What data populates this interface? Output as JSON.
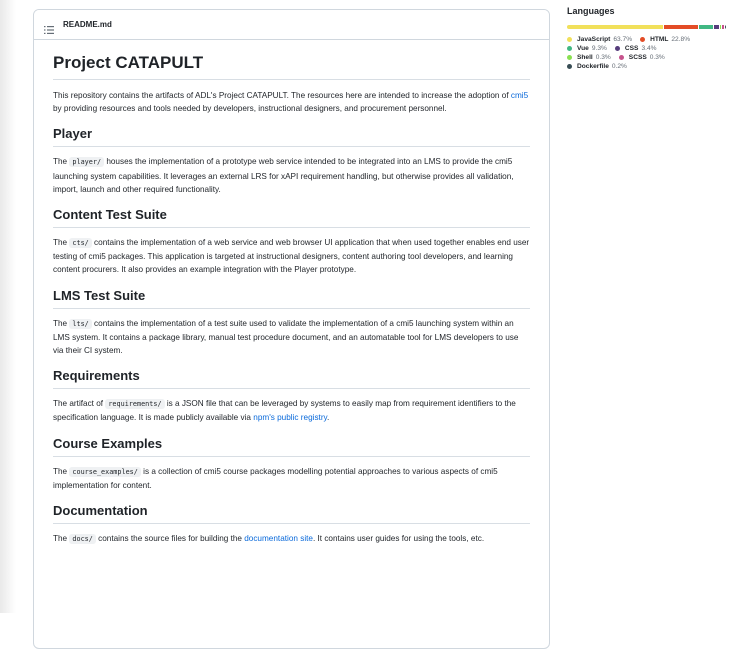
{
  "readme": {
    "filename": "README.md",
    "title": "Project CATAPULT",
    "intro": {
      "before": "This repository contains the artifacts of ADL's Project CATAPULT. The resources here are intended to increase the adoption of ",
      "link": "cmi5",
      "after": " by providing resources and tools needed by developers, instructional designers, and procurement personnel."
    },
    "sections": {
      "player": {
        "heading": "Player",
        "before": "The ",
        "code": "player/",
        "after": " houses the implementation of a prototype web service intended to be integrated into an LMS to provide the cmi5 launching system capabilities. It leverages an external LRS for xAPI requirement handling, but otherwise provides all validation, import, launch and other required functionality."
      },
      "cts": {
        "heading": "Content Test Suite",
        "before": "The ",
        "code": "cts/",
        "after": " contains the implementation of a web service and web browser UI application that when used together enables end user testing of cmi5 packages. This application is targeted at instructional designers, content authoring tool developers, and learning content procurers. It also provides an example integration with the Player prototype."
      },
      "lts": {
        "heading": "LMS Test Suite",
        "before": "The ",
        "code": "lts/",
        "after": " contains the implementation of a test suite used to validate the implementation of a cmi5 launching system within an LMS system. It contains a package library, manual test procedure document, and an automatable tool for LMS developers to use via their CI system."
      },
      "requirements": {
        "heading": "Requirements",
        "before": "The artifact of ",
        "code": "requirements/",
        "middle": " is a JSON file that can be leveraged by systems to easily map from requirement identifiers to the specification language. It is made publicly available via ",
        "link": "npm's public registry",
        "after": "."
      },
      "course": {
        "heading": "Course Examples",
        "before": "The ",
        "code": "course_examples/",
        "after": " is a collection of cmi5 course packages modelling potential approaches to various aspects of cmi5 implementation for content."
      },
      "docs": {
        "heading": "Documentation",
        "before": "The ",
        "code": "docs/",
        "middle": " contains the source files for building the ",
        "link": "documentation site",
        "after": ". It contains user guides for using the tools, etc."
      }
    }
  },
  "languages": {
    "title": "Languages",
    "items": [
      {
        "name": "JavaScript",
        "pct": "63.7%",
        "value": 63.7,
        "color": "#f1e05a"
      },
      {
        "name": "HTML",
        "pct": "22.8%",
        "value": 22.8,
        "color": "#e34c26"
      },
      {
        "name": "Vue",
        "pct": "9.3%",
        "value": 9.3,
        "color": "#41b883"
      },
      {
        "name": "CSS",
        "pct": "3.4%",
        "value": 3.4,
        "color": "#563d7c"
      },
      {
        "name": "Shell",
        "pct": "0.3%",
        "value": 0.3,
        "color": "#89e051"
      },
      {
        "name": "SCSS",
        "pct": "0.3%",
        "value": 0.3,
        "color": "#c6538c"
      },
      {
        "name": "Dockerfile",
        "pct": "0.2%",
        "value": 0.2,
        "color": "#384d54"
      }
    ]
  },
  "icons": {
    "file_list": "list-icon"
  }
}
